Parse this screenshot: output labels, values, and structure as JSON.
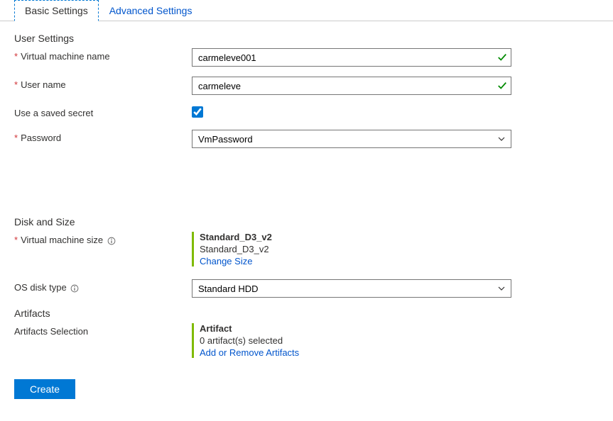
{
  "tabs": {
    "basic": "Basic Settings",
    "advanced": "Advanced Settings"
  },
  "sections": {
    "user_settings": "User Settings",
    "disk_and_size": "Disk and Size",
    "artifacts": "Artifacts"
  },
  "labels": {
    "vm_name": "Virtual machine name",
    "user_name": "User name",
    "saved_secret": "Use a saved secret",
    "password": "Password",
    "vm_size": "Virtual machine size",
    "os_disk_type": "OS disk type",
    "artifacts_selection": "Artifacts Selection"
  },
  "fields": {
    "vm_name": "carmeleve001",
    "user_name": "carmeleve",
    "saved_secret_checked": true,
    "password_selected": "VmPassword",
    "os_disk_type_selected": "Standard HDD"
  },
  "vm_size": {
    "title": "Standard_D3_v2",
    "subtitle": "Standard_D3_v2",
    "change_link": "Change Size"
  },
  "artifacts_block": {
    "title": "Artifact",
    "subtitle": "0 artifact(s) selected",
    "link": "Add or Remove Artifacts"
  },
  "buttons": {
    "create": "Create"
  }
}
